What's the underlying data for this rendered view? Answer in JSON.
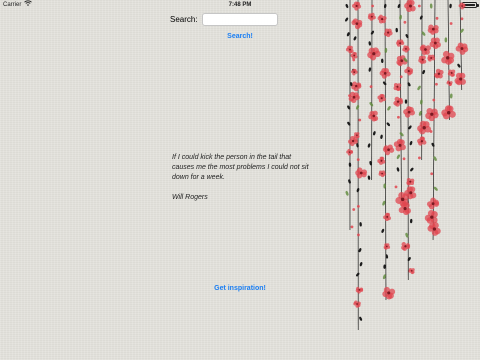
{
  "status_bar": {
    "carrier": "Carrier",
    "time": "7:48 PM",
    "battery_level": 1.0,
    "icons": [
      "wifi-icon",
      "battery-icon"
    ]
  },
  "search": {
    "label": "Search:",
    "value": "",
    "button_label": "Search!"
  },
  "quote": {
    "text": "If I could kick the person in the tail that causes me the most problems I could not sit down for a week.",
    "author": "Will Rogers"
  },
  "inspire_button_label": "Get inspiration!",
  "colors": {
    "accent": "#1a7ef3",
    "background": "#e4e3dd",
    "flower": "#e0454f",
    "stem": "#1c1c1c",
    "leaf": "#5e8a3a"
  }
}
